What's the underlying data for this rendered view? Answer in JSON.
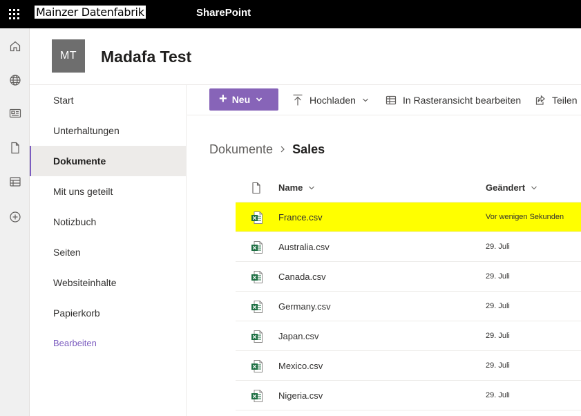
{
  "suite_bar": {
    "org_name": "Mainzer Datenfabrik",
    "app_name": "SharePoint",
    "icon": "waffle-icon"
  },
  "app_bar": {
    "items": [
      {
        "icon": "home-icon"
      },
      {
        "icon": "globe-icon"
      },
      {
        "icon": "news-icon"
      },
      {
        "icon": "document-icon"
      },
      {
        "icon": "list-icon"
      },
      {
        "icon": "add-circle-icon"
      }
    ]
  },
  "site": {
    "logo_initials": "MT",
    "title": "Madafa Test"
  },
  "left_nav": {
    "items": [
      {
        "label": "Start",
        "selected": false
      },
      {
        "label": "Unterhaltungen",
        "selected": false
      },
      {
        "label": "Dokumente",
        "selected": true
      },
      {
        "label": "Mit uns geteilt",
        "selected": false
      },
      {
        "label": "Notizbuch",
        "selected": false
      },
      {
        "label": "Seiten",
        "selected": false
      },
      {
        "label": "Websiteinhalte",
        "selected": false
      },
      {
        "label": "Papierkorb",
        "selected": false
      }
    ],
    "edit_label": "Bearbeiten"
  },
  "command_bar": {
    "new_label": "Neu",
    "upload_label": "Hochladen",
    "grid_edit_label": "In Rasteransicht bearbeiten",
    "share_label": "Teilen"
  },
  "breadcrumb": {
    "parent": "Dokumente",
    "current": "Sales"
  },
  "file_list": {
    "columns": {
      "name": "Name",
      "modified": "Geändert"
    },
    "rows": [
      {
        "name": "France.csv",
        "modified": "Vor wenigen Sekunden",
        "highlighted": true
      },
      {
        "name": "Australia.csv",
        "modified": "29. Juli",
        "highlighted": false
      },
      {
        "name": "Canada.csv",
        "modified": "29. Juli",
        "highlighted": false
      },
      {
        "name": "Germany.csv",
        "modified": "29. Juli",
        "highlighted": false
      },
      {
        "name": "Japan.csv",
        "modified": "29. Juli",
        "highlighted": false
      },
      {
        "name": "Mexico.csv",
        "modified": "29. Juli",
        "highlighted": false
      },
      {
        "name": "Nigeria.csv",
        "modified": "29. Juli",
        "highlighted": false
      }
    ]
  },
  "colors": {
    "accent": "#8764b8",
    "nav_selected_bar": "#7b5cbf",
    "highlight": "#ffff00",
    "excel_green": "#1d6f42"
  }
}
